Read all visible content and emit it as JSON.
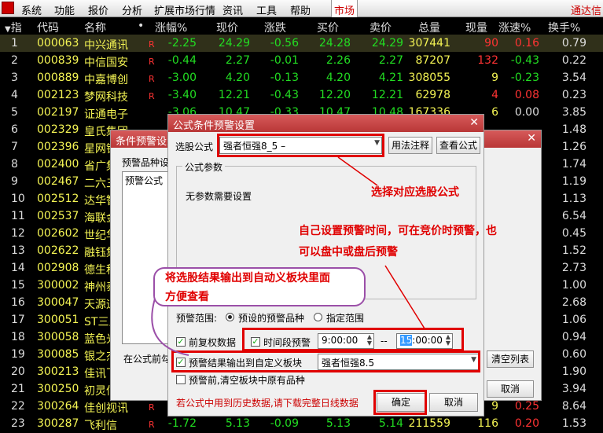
{
  "menu": {
    "items": [
      "系统",
      "功能",
      "报价",
      "分析",
      "扩展市场行情",
      "资讯",
      "工具",
      "帮助"
    ],
    "market_tab": "市场",
    "right_text": "通达信"
  },
  "table": {
    "header": {
      "sort": "指",
      "code": "代码",
      "name": "名称",
      "dot": "•",
      "change_pct": "涨幅%",
      "price": "现价",
      "change": "涨跌",
      "bid": "买价",
      "ask": "卖价",
      "volume": "总量",
      "cur_vol": "现量",
      "speed": "涨速%",
      "turnover": "换手%"
    },
    "rows": [
      {
        "idx": "1",
        "code": "000063",
        "name": "中兴通讯",
        "r": "R",
        "pct": "-2.25",
        "price": "24.29",
        "chg": "-0.56",
        "bid": "24.28",
        "ask": "24.29",
        "vol": "307441",
        "cur": "90",
        "spd": "0.16",
        "to": "0.79"
      },
      {
        "idx": "2",
        "code": "000839",
        "name": "中信国安",
        "r": "R",
        "pct": "-0.44",
        "price": "2.27",
        "chg": "-0.01",
        "bid": "2.26",
        "ask": "2.27",
        "vol": "87207",
        "cur": "132",
        "spd": "-0.43",
        "to": "0.22"
      },
      {
        "idx": "3",
        "code": "000889",
        "name": "中嘉博创",
        "r": "R",
        "pct": "-3.00",
        "price": "4.20",
        "chg": "-0.13",
        "bid": "4.20",
        "ask": "4.21",
        "vol": "308055",
        "cur": "9",
        "spd": "-0.23",
        "to": "3.54"
      },
      {
        "idx": "4",
        "code": "002123",
        "name": "梦网科技",
        "r": "R",
        "pct": "-3.40",
        "price": "12.21",
        "chg": "-0.43",
        "bid": "12.20",
        "ask": "12.21",
        "vol": "62978",
        "cur": "4",
        "spd": "0.08",
        "to": "0.23"
      },
      {
        "idx": "5",
        "code": "002197",
        "name": "证通电子",
        "r": "",
        "pct": "-3.06",
        "price": "10.47",
        "chg": "-0.33",
        "bid": "10.47",
        "ask": "10.48",
        "vol": "167336",
        "cur": "6",
        "spd": "0.00",
        "to": "3.85"
      },
      {
        "idx": "6",
        "code": "002329",
        "name": "皇氏集团",
        "to": "1.48"
      },
      {
        "idx": "7",
        "code": "002396",
        "name": "星网锐捷",
        "to": "1.26"
      },
      {
        "idx": "8",
        "code": "002400",
        "name": "省广集团",
        "to": "1.74"
      },
      {
        "idx": "9",
        "code": "002467",
        "name": "二六三",
        "to": "1.19"
      },
      {
        "idx": "10",
        "code": "002512",
        "name": "达华智能",
        "to": "1.13"
      },
      {
        "idx": "11",
        "code": "002537",
        "name": "海联金汇",
        "to": "6.54"
      },
      {
        "idx": "12",
        "code": "002602",
        "name": "世纪华通",
        "to": "0.45"
      },
      {
        "idx": "13",
        "code": "002622",
        "name": "融钰集团",
        "to": "1.52"
      },
      {
        "idx": "14",
        "code": "002908",
        "name": "德生科技",
        "to": "2.73"
      },
      {
        "idx": "15",
        "code": "300002",
        "name": "神州泰岳",
        "to": "1.00"
      },
      {
        "idx": "16",
        "code": "300047",
        "name": "天源迪科",
        "to": "2.68"
      },
      {
        "idx": "17",
        "code": "300051",
        "name": "ST三五",
        "to": "1.06"
      },
      {
        "idx": "18",
        "code": "300058",
        "name": "蓝色光标",
        "to": "0.94"
      },
      {
        "idx": "19",
        "code": "300085",
        "name": "银之杰",
        "to": "0.60"
      },
      {
        "idx": "20",
        "code": "300213",
        "name": "佳讯飞鸿",
        "to": "1.90"
      },
      {
        "idx": "21",
        "code": "300250",
        "name": "初灵信息",
        "to": "3.94"
      },
      {
        "idx": "22",
        "code": "300264",
        "name": "佳创视讯",
        "r": "R",
        "pct": "",
        "price": "",
        "chg": "",
        "bid": "",
        "ask": "",
        "vol": "",
        "cur": "9",
        "spd": "0.25",
        "to": "8.64"
      },
      {
        "idx": "23",
        "code": "300287",
        "name": "飞利信",
        "r": "R",
        "pct": "-1.72",
        "price": "5.13",
        "chg": "-0.09",
        "bid": "5.13",
        "ask": "5.14",
        "vol": "211559",
        "cur": "116",
        "spd": "0.20",
        "to": "1.53"
      }
    ]
  },
  "back_dialog": {
    "title": "条件预警设置",
    "group_label": "预警品种设",
    "col_label": "预警公式",
    "bottom_label": "在公式前勾",
    "clear_btn": "清空列表",
    "cancel_btn": "取消"
  },
  "main_dialog": {
    "title": "公式条件预警设置",
    "formula_label": "选股公式",
    "formula_value": "强者恒强8_5  –",
    "usage_btn": "用法注释",
    "view_btn": "查看公式",
    "params_group": "公式参数",
    "params_text": "无参数需要设置",
    "range_label": "预警范围:",
    "range_opt1": "预设的预警品种",
    "range_opt2": "指定范围",
    "restore_label": "前复权数据",
    "period_label": "时间段预警",
    "time_start": "9:00:00",
    "time_sep": "--",
    "time_end_hl": "15",
    "time_end_rest": ":00:00",
    "output_label": "预警结果输出到自定义板块",
    "output_value": "强者恒强8.5",
    "clear_label": "预警前,清空板块中原有品种",
    "note": "若公式中用到历史数据,请下载完整日线数据",
    "ok_btn": "确定",
    "cancel_btn": "取消"
  },
  "annotations": {
    "a1": "选择对应选股公式",
    "a2_line1": "自己设置预警时间，可在竞价时预警，也",
    "a2_line2": "可以盘中或盘后预警",
    "a3_line1": "将选股结果输出到自动义板块里面",
    "a3_line2": "方便查看"
  },
  "colors": {
    "annotation": "#e00000",
    "title_bar": "#c04040",
    "code": "#f4f454",
    "down": "#22dd22",
    "up": "#ff3333"
  }
}
